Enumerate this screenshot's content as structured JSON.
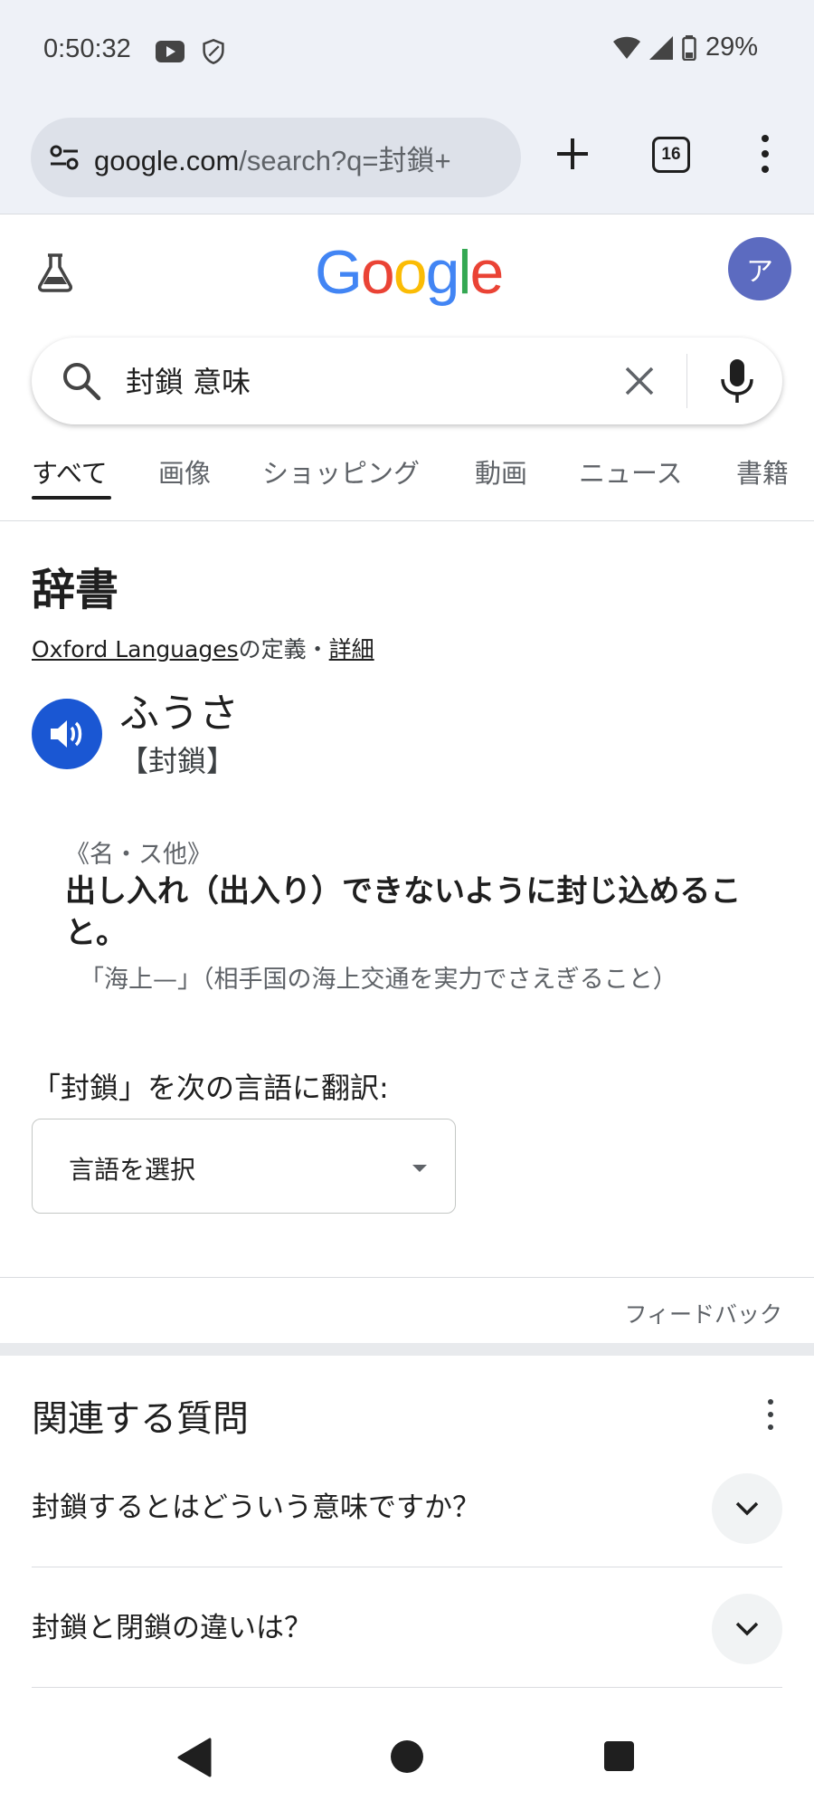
{
  "status_bar": {
    "time": "0:50:32",
    "battery": "29%",
    "icons": [
      "youtube-icon",
      "shield-icon",
      "wifi-icon",
      "signal-icon",
      "battery-icon"
    ]
  },
  "browser": {
    "url_host": "google.com",
    "url_rest": "/search?q=封鎖+",
    "tab_count": "16"
  },
  "header": {
    "logo_letters": [
      "G",
      "o",
      "o",
      "g",
      "l",
      "e"
    ],
    "logo_colors": [
      "#4285F4",
      "#EA4335",
      "#FBBC05",
      "#4285F4",
      "#34A853",
      "#EA4335"
    ],
    "avatar_letter": "ア"
  },
  "search": {
    "query": "封鎖 意味"
  },
  "tabs": [
    {
      "label": "すべて",
      "active": true
    },
    {
      "label": "画像",
      "active": false
    },
    {
      "label": "ショッピング",
      "active": false
    },
    {
      "label": "動画",
      "active": false
    },
    {
      "label": "ニュース",
      "active": false
    },
    {
      "label": "書籍",
      "active": false
    }
  ],
  "dictionary": {
    "title": "辞書",
    "source_link": "Oxford Languages",
    "source_suffix": "の定義・",
    "details_link": "詳細",
    "reading": "ふうさ",
    "kanji": "【封鎖】",
    "part_of_speech": "《名・ス他》",
    "definition": "出し入れ（出入り）できないように封じ込めること。",
    "example": "「海上—」（相手国の海上交通を実力でさえぎること）",
    "translate_label": "「封鎖」を次の言語に翻訳:",
    "language_select": "言語を選択",
    "feedback": "フィードバック"
  },
  "related": {
    "title": "関連する質問",
    "questions": [
      "封鎖するとはどういう意味ですか？",
      "封鎖と閉鎖の違いは？"
    ]
  }
}
